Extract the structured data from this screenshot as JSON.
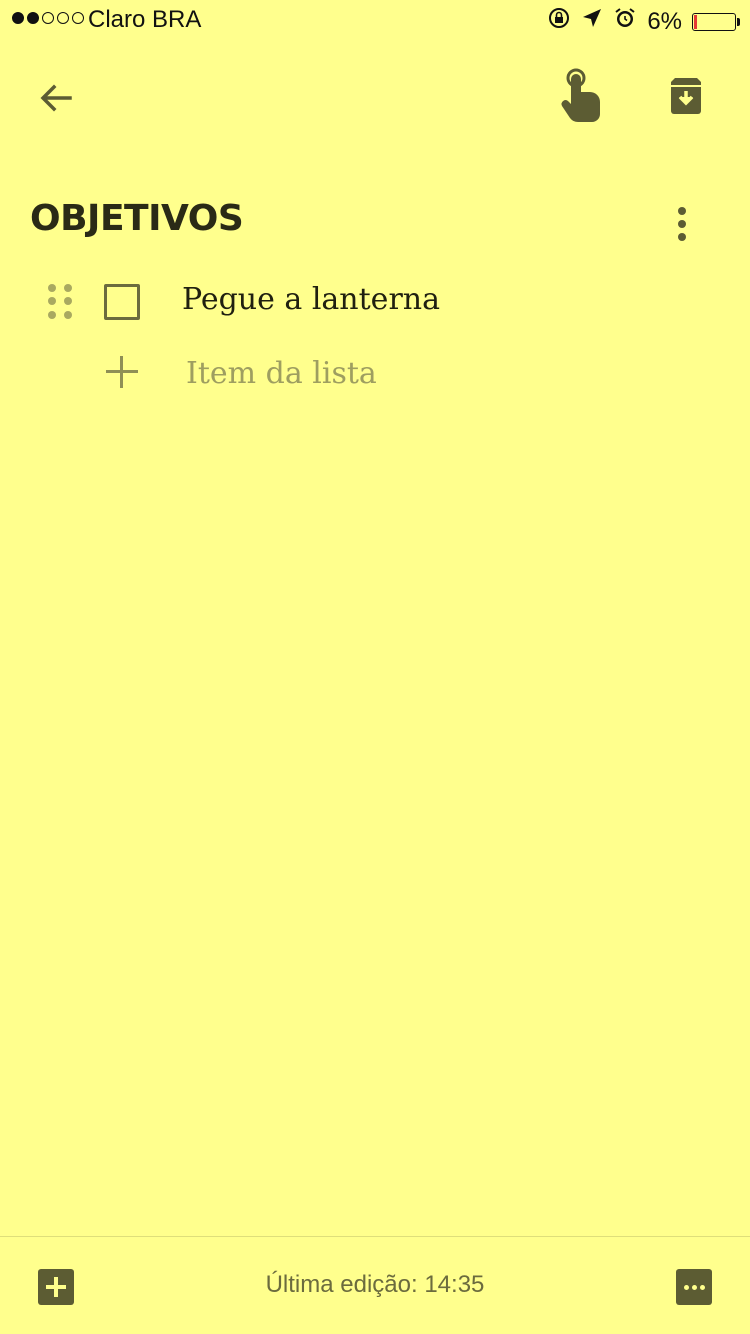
{
  "status_bar": {
    "signal_filled": 2,
    "signal_total": 5,
    "carrier": "Claro BRA",
    "battery_percent": "6%",
    "battery_level": 0.06
  },
  "toolbar": {
    "back_icon": "arrow-back-icon",
    "pin_icon": "reminder-hand-icon",
    "archive_icon": "archive-icon"
  },
  "note": {
    "title": "OBJETIVOS",
    "items": [
      {
        "text": "Pegue a lanterna",
        "checked": false
      }
    ],
    "add_item_placeholder": "Item da lista"
  },
  "bottom_bar": {
    "last_edit": "Última edição: 14:35"
  },
  "colors": {
    "background": "#FFFF8D",
    "icon": "#5c5c33",
    "placeholder": "#9e9e60"
  }
}
